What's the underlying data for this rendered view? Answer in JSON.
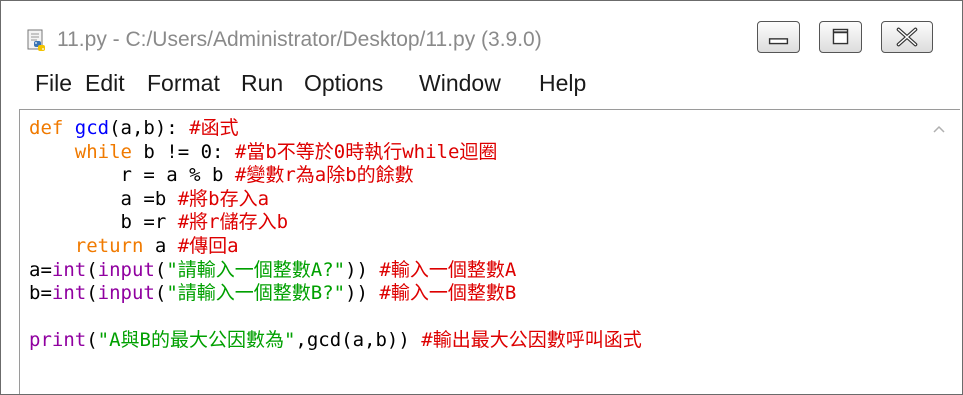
{
  "window": {
    "title": "11.py - C:/Users/Administrator/Desktop/11.py (3.9.0)",
    "icon": "python-file-icon",
    "controls": [
      "minimize-icon",
      "maximize-icon",
      "close-icon"
    ]
  },
  "menu": [
    "File",
    "Edit",
    "Format",
    "Run",
    "Options",
    "Window",
    "Help"
  ],
  "colors": {
    "keyword": "#f07a00",
    "definition": "#0000ff",
    "builtin": "#9000a0",
    "string": "#00a000",
    "comment": "#dd0000",
    "text": "#000000"
  },
  "code": [
    [
      {
        "t": "kw",
        "v": "def"
      },
      {
        "t": "tx",
        "v": " "
      },
      {
        "t": "def",
        "v": "gcd"
      },
      {
        "t": "tx",
        "v": "(a,b): "
      },
      {
        "t": "cm",
        "v": "#函式"
      }
    ],
    [
      {
        "t": "tx",
        "v": "    "
      },
      {
        "t": "kw",
        "v": "while"
      },
      {
        "t": "tx",
        "v": " b != 0: "
      },
      {
        "t": "cm",
        "v": "#當b不等於0時執行while迴圈"
      }
    ],
    [
      {
        "t": "tx",
        "v": "        r = a % b "
      },
      {
        "t": "cm",
        "v": "#變數r為a除b的餘數"
      }
    ],
    [
      {
        "t": "tx",
        "v": "        a =b "
      },
      {
        "t": "cm",
        "v": "#將b存入a"
      }
    ],
    [
      {
        "t": "tx",
        "v": "        b =r "
      },
      {
        "t": "cm",
        "v": "#將r儲存入b"
      }
    ],
    [
      {
        "t": "tx",
        "v": "    "
      },
      {
        "t": "kw",
        "v": "return"
      },
      {
        "t": "tx",
        "v": " a "
      },
      {
        "t": "cm",
        "v": "#傳回a"
      }
    ],
    [
      {
        "t": "tx",
        "v": "a="
      },
      {
        "t": "bi",
        "v": "int"
      },
      {
        "t": "tx",
        "v": "("
      },
      {
        "t": "bi",
        "v": "input"
      },
      {
        "t": "tx",
        "v": "("
      },
      {
        "t": "str",
        "v": "\"請輸入一個整數A?\""
      },
      {
        "t": "tx",
        "v": ")) "
      },
      {
        "t": "cm",
        "v": "#輸入一個整數A"
      }
    ],
    [
      {
        "t": "tx",
        "v": "b="
      },
      {
        "t": "bi",
        "v": "int"
      },
      {
        "t": "tx",
        "v": "("
      },
      {
        "t": "bi",
        "v": "input"
      },
      {
        "t": "tx",
        "v": "("
      },
      {
        "t": "str",
        "v": "\"請輸入一個整數B?\""
      },
      {
        "t": "tx",
        "v": ")) "
      },
      {
        "t": "cm",
        "v": "#輸入一個整數B"
      }
    ],
    [],
    [
      {
        "t": "bi",
        "v": "print"
      },
      {
        "t": "tx",
        "v": "("
      },
      {
        "t": "str",
        "v": "\"A與B的最大公因數為\""
      },
      {
        "t": "tx",
        "v": ",gcd(a,b)) "
      },
      {
        "t": "cm",
        "v": "#輸出最大公因數呼叫函式"
      }
    ]
  ]
}
